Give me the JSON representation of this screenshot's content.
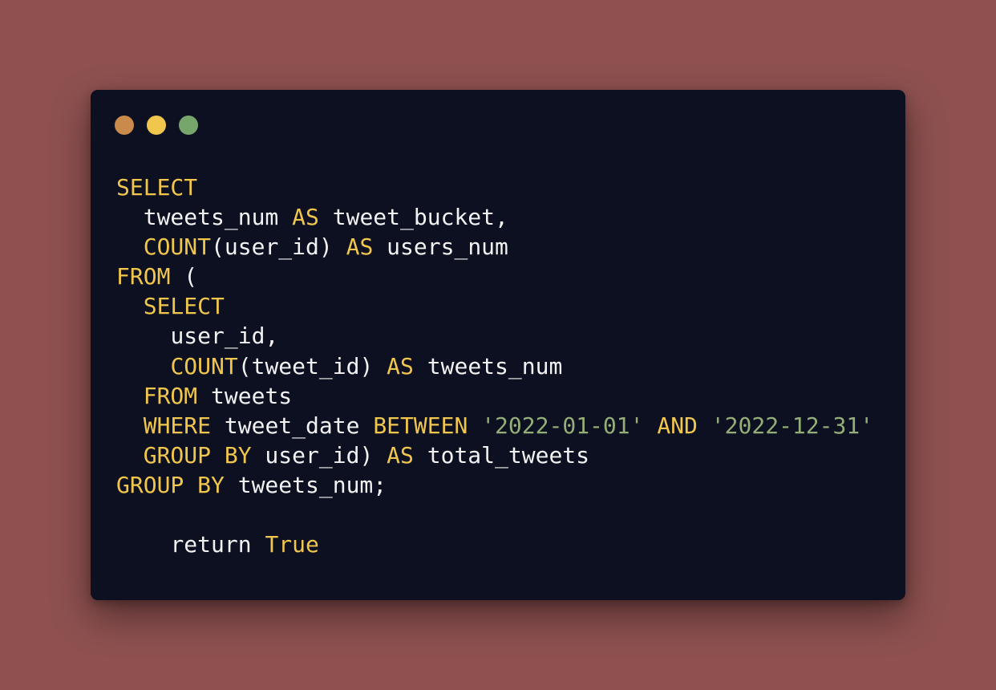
{
  "window": {
    "traffic_lights": [
      {
        "name": "close",
        "color": "#c98a4b"
      },
      {
        "name": "minimize",
        "color": "#f0c64d"
      },
      {
        "name": "maximize",
        "color": "#76a66b"
      }
    ]
  },
  "colors": {
    "background": "#8e5150",
    "panel": "#0c1020",
    "keyword": "#f0c64d",
    "identifier": "#f2f2f2",
    "string": "#95ae78"
  },
  "code": {
    "language": "sql",
    "lines": [
      [
        {
          "t": "kw",
          "v": "SELECT"
        }
      ],
      [
        {
          "t": "ws",
          "v": "  "
        },
        {
          "t": "id",
          "v": "tweets_num "
        },
        {
          "t": "kw",
          "v": "AS"
        },
        {
          "t": "id",
          "v": " tweet_bucket,"
        }
      ],
      [
        {
          "t": "ws",
          "v": "  "
        },
        {
          "t": "kw",
          "v": "COUNT"
        },
        {
          "t": "id",
          "v": "(user_id) "
        },
        {
          "t": "kw",
          "v": "AS"
        },
        {
          "t": "id",
          "v": " users_num"
        }
      ],
      [
        {
          "t": "kw",
          "v": "FROM"
        },
        {
          "t": "id",
          "v": " ("
        }
      ],
      [
        {
          "t": "ws",
          "v": "  "
        },
        {
          "t": "kw",
          "v": "SELECT"
        }
      ],
      [
        {
          "t": "ws",
          "v": "    "
        },
        {
          "t": "id",
          "v": "user_id,"
        }
      ],
      [
        {
          "t": "ws",
          "v": "    "
        },
        {
          "t": "kw",
          "v": "COUNT"
        },
        {
          "t": "id",
          "v": "(tweet_id) "
        },
        {
          "t": "kw",
          "v": "AS"
        },
        {
          "t": "id",
          "v": " tweets_num"
        }
      ],
      [
        {
          "t": "ws",
          "v": "  "
        },
        {
          "t": "kw",
          "v": "FROM"
        },
        {
          "t": "id",
          "v": " tweets"
        }
      ],
      [
        {
          "t": "ws",
          "v": "  "
        },
        {
          "t": "kw",
          "v": "WHERE"
        },
        {
          "t": "id",
          "v": " tweet_date "
        },
        {
          "t": "kw",
          "v": "BETWEEN"
        },
        {
          "t": "ws",
          "v": " "
        },
        {
          "t": "str",
          "v": "'2022-01-01'"
        },
        {
          "t": "ws",
          "v": " "
        },
        {
          "t": "kw",
          "v": "AND"
        },
        {
          "t": "ws",
          "v": " "
        },
        {
          "t": "str",
          "v": "'2022-12-31'"
        }
      ],
      [
        {
          "t": "ws",
          "v": "  "
        },
        {
          "t": "kw",
          "v": "GROUP BY"
        },
        {
          "t": "id",
          "v": " user_id) "
        },
        {
          "t": "kw",
          "v": "AS"
        },
        {
          "t": "id",
          "v": " total_tweets"
        }
      ],
      [
        {
          "t": "kw",
          "v": "GROUP BY"
        },
        {
          "t": "id",
          "v": " tweets_num;"
        }
      ],
      [],
      [
        {
          "t": "ws",
          "v": "    "
        },
        {
          "t": "id",
          "v": "return "
        },
        {
          "t": "kw",
          "v": "True"
        }
      ]
    ]
  }
}
